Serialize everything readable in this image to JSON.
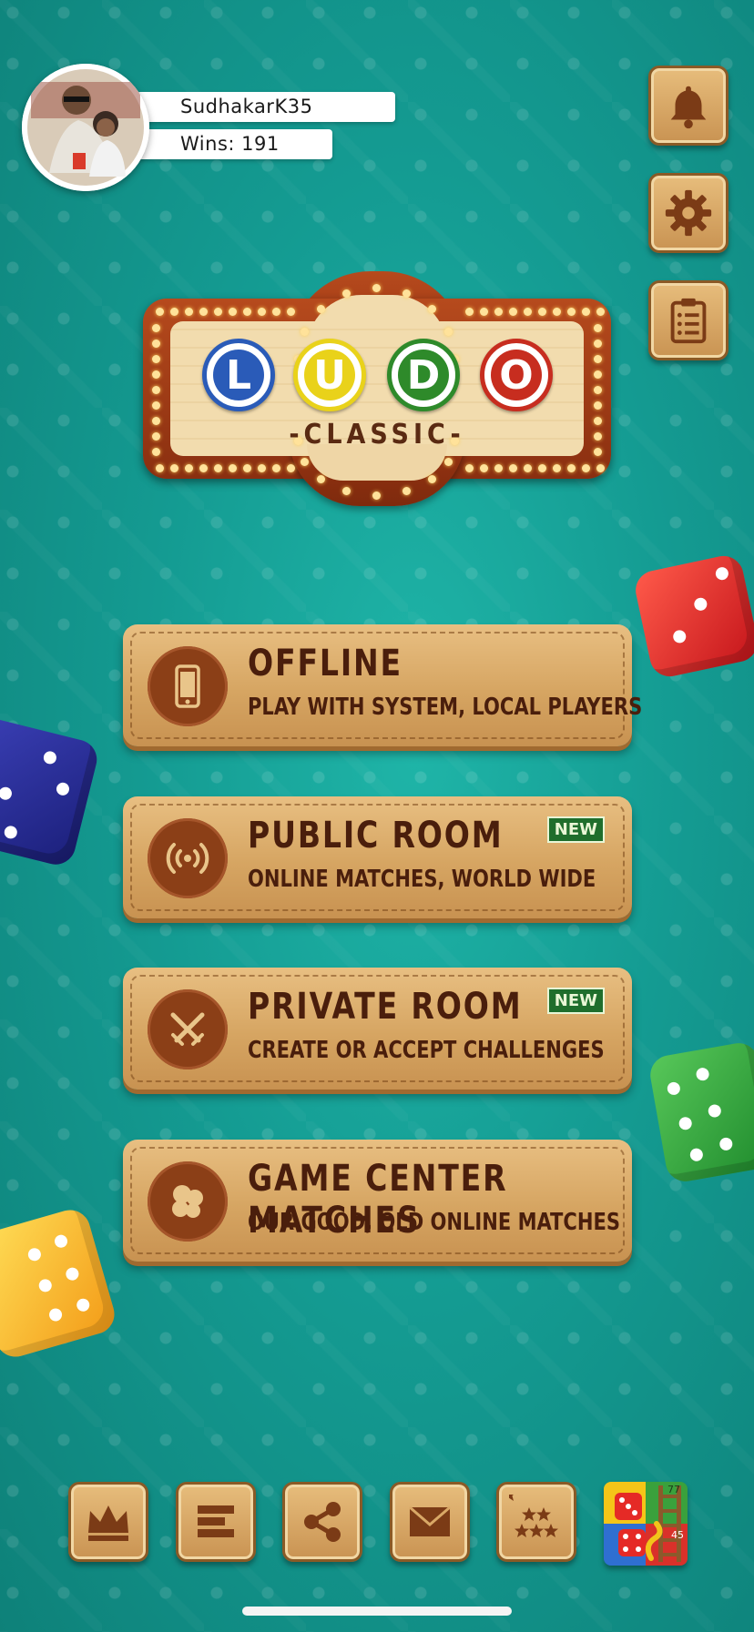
{
  "profile": {
    "username": "SudhakarK35",
    "wins_text": "Wins: 191"
  },
  "side_buttons": [
    {
      "name": "notifications",
      "icon": "bell-icon"
    },
    {
      "name": "settings",
      "icon": "gear-icon"
    },
    {
      "name": "clipboard",
      "icon": "clipboard-list-icon"
    }
  ],
  "logo": {
    "letters": [
      "L",
      "U",
      "D",
      "O"
    ],
    "letter_colors": [
      "#2a5bb8",
      "#e9d21a",
      "#2e8a2a",
      "#c72d1f"
    ],
    "subtitle": "-CLASSIC-"
  },
  "menu": [
    {
      "title": "OFFLINE",
      "subtitle": "PLAY WITH SYSTEM, LOCAL PLAYERS",
      "icon": "phone-icon",
      "badge": ""
    },
    {
      "title": "PUBLIC ROOM",
      "subtitle": "ONLINE MATCHES, WORLD WIDE",
      "icon": "broadcast-icon",
      "badge": "NEW"
    },
    {
      "title": "PRIVATE ROOM",
      "subtitle": "CREATE OR ACCEPT CHALLENGES",
      "icon": "crossed-swords-icon",
      "badge": "NEW"
    },
    {
      "title": "GAME CENTER MATCHES",
      "subtitle": "OUR GOOD, OLD ONLINE MATCHES",
      "icon": "game-center-icon",
      "badge": ""
    }
  ],
  "bottom_bar": [
    {
      "name": "leaderboard",
      "icon": "crown-icon"
    },
    {
      "name": "stats",
      "icon": "bars-icon"
    },
    {
      "name": "share",
      "icon": "share-icon"
    },
    {
      "name": "mail",
      "icon": "envelope-icon"
    },
    {
      "name": "rate",
      "icon": "stars-icon"
    },
    {
      "name": "snakes-ladders-promo",
      "icon": "snakes-ladders-app-icon",
      "numbers": [
        "77",
        "45"
      ]
    }
  ],
  "colors": {
    "background": "#149b92",
    "button_leather": "#d6a562",
    "button_text": "#4a1e0c",
    "badge_green": "#1f6e2c"
  }
}
